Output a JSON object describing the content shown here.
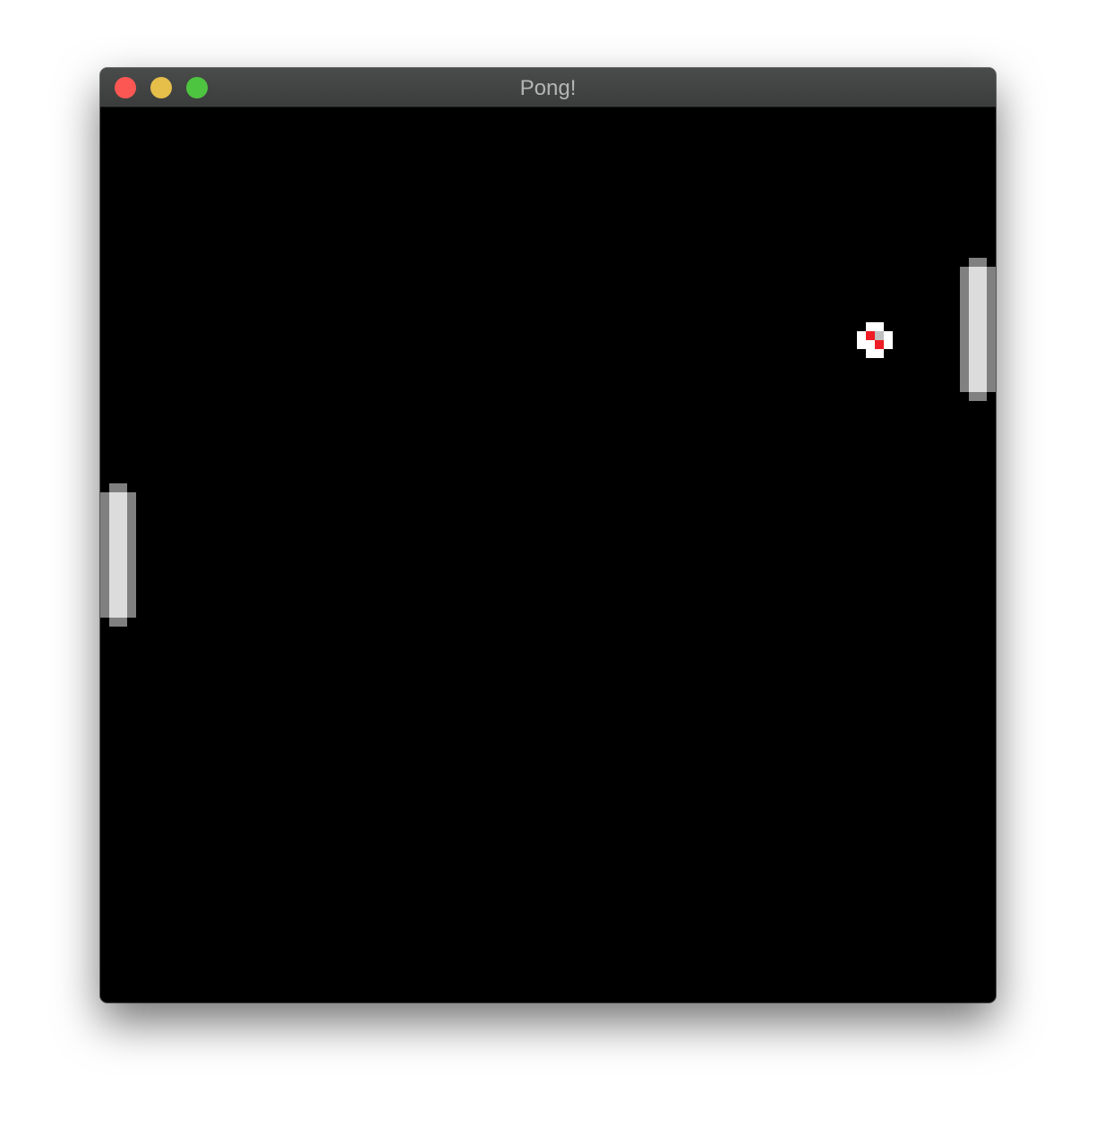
{
  "window": {
    "title": "Pong!",
    "controls": {
      "close_color": "#fd5753",
      "minimize_color": "#e6bf4a",
      "zoom_color": "#4ec540"
    }
  },
  "game": {
    "background_color": "#000000",
    "paddle_color": "#dcdcdc",
    "paddle_edge_color": "#808080",
    "ball_colors": {
      "white": "#ffffff",
      "red": "#ee1c24",
      "grey": "#c0c0c0"
    }
  }
}
